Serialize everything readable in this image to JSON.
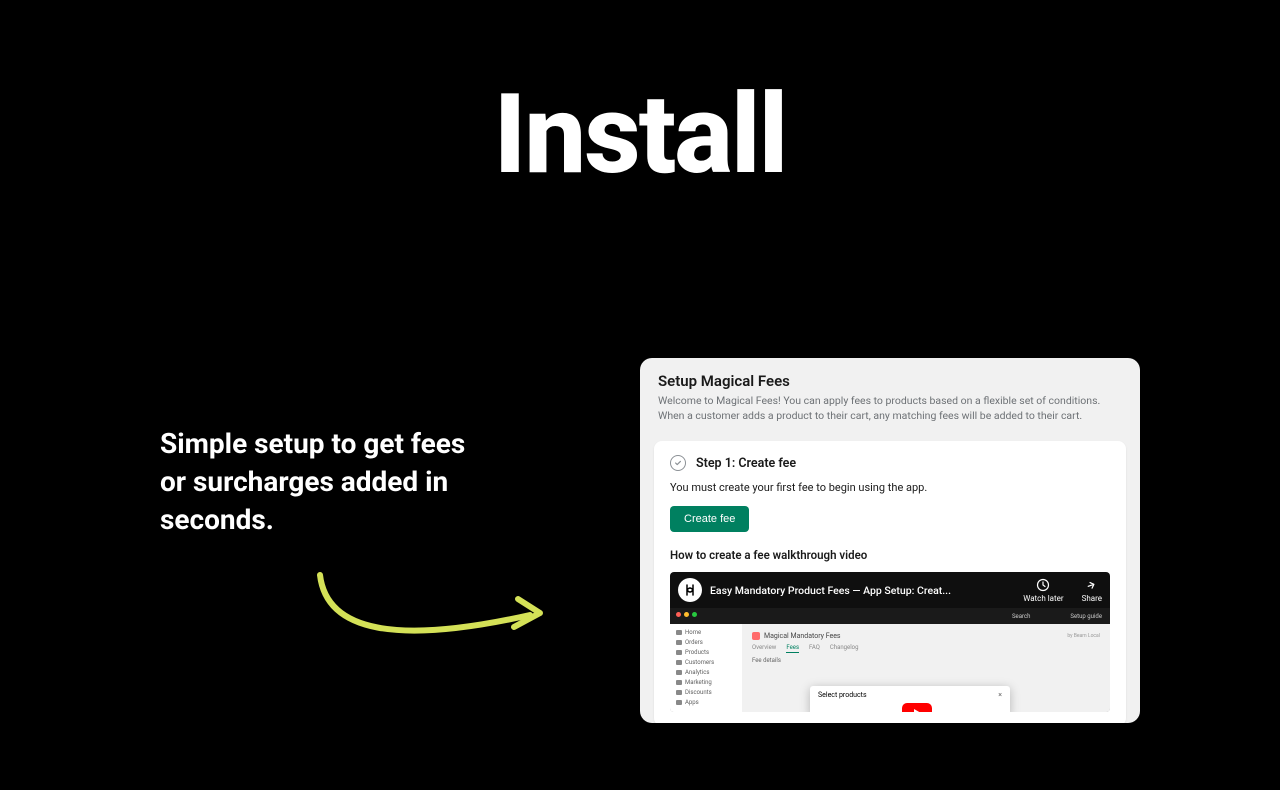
{
  "headline": "Install",
  "subhead": "Simple setup to get fees or surcharges added in seconds.",
  "panel": {
    "title": "Setup Magical Fees",
    "desc": "Welcome to Magical Fees! You can apply fees to products based on a flexible set of conditions. When a customer adds a product to their cart, any matching fees will be added to their cart."
  },
  "step": {
    "title": "Step 1: Create fee",
    "desc": "You must create your first fee to begin using the app.",
    "button": "Create fee"
  },
  "video": {
    "label": "How to create a fee walkthrough video",
    "title": "Easy Mandatory Product Fees — App Setup: Creat...",
    "watch_later": "Watch later",
    "share": "Share"
  },
  "embed": {
    "app_title": "Magical Mandatory Fees",
    "byline": "by Beam Local",
    "nav": {
      "home": "Home",
      "orders": "Orders",
      "products": "Products",
      "customers": "Customers",
      "analytics": "Analytics",
      "marketing": "Marketing",
      "discounts": "Discounts",
      "apps": "Apps"
    },
    "tabs": {
      "overview": "Overview",
      "fees": "Fees",
      "faq": "FAQ",
      "changelog": "Changelog"
    },
    "section": "Fee details",
    "modal_title": "Select products",
    "modal_close": "×",
    "search": "Search",
    "setup_guide": "Setup guide"
  }
}
